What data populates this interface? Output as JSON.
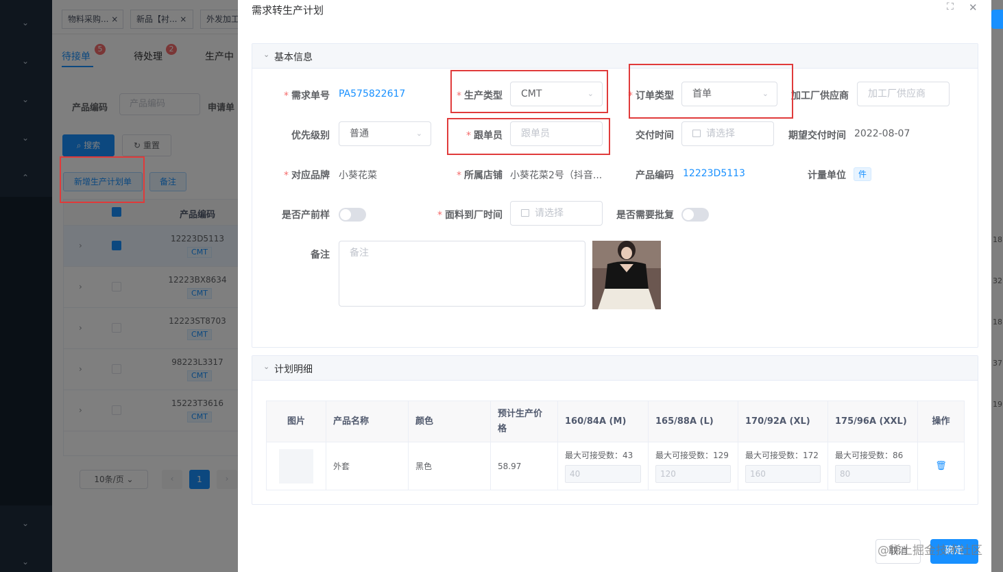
{
  "background": {
    "tags": [
      "物料采购...",
      "新品【衬...",
      "外发加工"
    ],
    "tabs": [
      {
        "label": "待接单",
        "badge": "5"
      },
      {
        "label": "待处理",
        "badge": "2"
      },
      {
        "label": "生产中",
        "badge": ""
      }
    ],
    "filters": {
      "product_code_label": "产品编码",
      "product_code_placeholder": "产品编码",
      "request_label": "申请单"
    },
    "buttons": {
      "search": "搜索",
      "reset": "重置",
      "new_plan": "新增生产计划单",
      "remark": "备注"
    },
    "table": {
      "header_code": "产品编码",
      "rows": [
        {
          "code": "12223D5113",
          "type": "CMT",
          "selected": true,
          "right_num": "18"
        },
        {
          "code": "12223BX8634",
          "type": "CMT",
          "selected": false,
          "right_num": "32"
        },
        {
          "code": "12223ST8703",
          "type": "CMT",
          "selected": false,
          "right_num": "18"
        },
        {
          "code": "98223L3317",
          "type": "CMT",
          "selected": false,
          "right_num": "37"
        },
        {
          "code": "15223T3616",
          "type": "CMT",
          "selected": false,
          "right_num": "19"
        }
      ]
    },
    "pagination": {
      "page_size": "10条/页",
      "current_page": "1"
    }
  },
  "dialog": {
    "title": "需求转生产计划",
    "basic_section": "基本信息",
    "fields": {
      "request_no_label": "需求单号",
      "request_no": "PA575822617",
      "production_type_label": "生产类型",
      "production_type": "CMT",
      "order_type_label": "订单类型",
      "order_type": "首单",
      "supplier_label": "加工厂供应商",
      "supplier_placeholder": "加工厂供应商",
      "priority_label": "优先级别",
      "priority": "普通",
      "follower_label": "跟单员",
      "follower_placeholder": "跟单员",
      "delivery_time_label": "交付时间",
      "delivery_time_placeholder": "请选择",
      "expected_delivery_label": "期望交付时间",
      "expected_delivery": "2022-08-07",
      "brand_label": "对应品牌",
      "brand": "小葵花菜",
      "store_label": "所属店铺",
      "store": "小葵花菜2号（抖音...",
      "product_code_label": "产品编码",
      "product_code": "12223D5113",
      "unit_label": "计量单位",
      "unit": "件",
      "pre_sample_label": "是否产前样",
      "fabric_arrival_label": "面料到厂时间",
      "fabric_arrival_placeholder": "请选择",
      "need_approval_label": "是否需要批复",
      "remark_label": "备注",
      "remark_placeholder": "备注"
    },
    "plan_section": "计划明细",
    "plan_table": {
      "headers": [
        "图片",
        "产品名称",
        "颜色",
        "预计生产价格",
        "160/84A (M)",
        "165/88A (L)",
        "170/92A (XL)",
        "175/96A (XXL)",
        "操作"
      ],
      "row": {
        "name": "外套",
        "color": "黑色",
        "price": "58.97",
        "sizes": [
          {
            "max_label": "最大可接受数：43",
            "value": "40"
          },
          {
            "max_label": "最大可接受数：129",
            "value": "120"
          },
          {
            "max_label": "最大可接受数：172",
            "value": "160"
          },
          {
            "max_label": "最大可接受数：86",
            "value": "80"
          }
        ]
      }
    },
    "footer": {
      "cancel": "取消",
      "confirm": "确定"
    }
  },
  "watermark": "@稀土掘金技术社区",
  "colors": {
    "primary": "#1890ff",
    "required": "#f56c6c",
    "highlight_box": "#e03a3a"
  }
}
